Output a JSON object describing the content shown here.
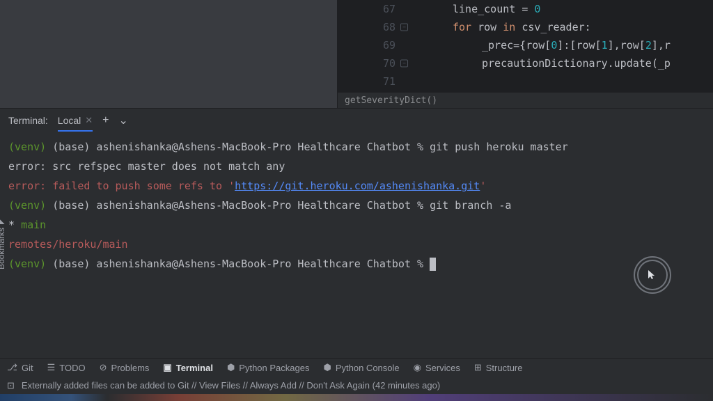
{
  "editor": {
    "lines": [
      {
        "num": "67",
        "fold": false,
        "code_html": "line_count = <span class='num'>0</span>",
        "indent": 560
      },
      {
        "num": "68",
        "fold": true,
        "code_html": "<span class='kw'>for</span> row <span class='kw'>in</span> csv_reader:",
        "indent": 560
      },
      {
        "num": "69",
        "fold": false,
        "code_html": "_prec={row[<span class='num'>0</span>]:[row[<span class='num'>1</span>],row[<span class='num'>2</span>],r",
        "indent": 602
      },
      {
        "num": "70",
        "fold": true,
        "code_html": "precautionDictionary.update(_p",
        "indent": 602
      },
      {
        "num": "71",
        "fold": false,
        "code_html": "",
        "indent": 560
      }
    ],
    "breadcrumb": "getSeverityDict()"
  },
  "terminal": {
    "title": "Terminal:",
    "tab": "Local",
    "lines": [
      {
        "segments": [
          {
            "cls": "t-green",
            "text": "(venv) "
          },
          {
            "cls": "",
            "text": "(base) ashenishanka@Ashens-MacBook-Pro Healthcare Chatbot % git push heroku master"
          }
        ]
      },
      {
        "segments": [
          {
            "cls": "",
            "text": "error: src refspec master does not match any"
          }
        ]
      },
      {
        "segments": [
          {
            "cls": "t-red",
            "text": "error: failed to push some refs to '"
          },
          {
            "cls": "t-url",
            "text": "https://git.heroku.com/ashenishanka.git"
          },
          {
            "cls": "t-red",
            "text": "'"
          }
        ]
      },
      {
        "segments": [
          {
            "cls": "t-green",
            "text": "(venv) "
          },
          {
            "cls": "",
            "text": "(base) ashenishanka@Ashens-MacBook-Pro Healthcare Chatbot % git branch -a"
          }
        ]
      },
      {
        "segments": [
          {
            "cls": "",
            "text": "* "
          },
          {
            "cls": "t-green",
            "text": "main"
          }
        ]
      },
      {
        "segments": [
          {
            "cls": "t-red",
            "text": "  remotes/heroku/main"
          }
        ]
      },
      {
        "segments": [
          {
            "cls": "t-green",
            "text": "(venv) "
          },
          {
            "cls": "",
            "text": "(base) ashenishanka@Ashens-MacBook-Pro Healthcare Chatbot % "
          }
        ],
        "cursor": true
      }
    ]
  },
  "bottom_tabs": [
    {
      "icon": "⎇",
      "label": "Git"
    },
    {
      "icon": "☰",
      "label": "TODO"
    },
    {
      "icon": "⊘",
      "label": "Problems"
    },
    {
      "icon": "▣",
      "label": "Terminal",
      "active": true
    },
    {
      "icon": "⬢",
      "label": "Python Packages"
    },
    {
      "icon": "⬢",
      "label": "Python Console"
    },
    {
      "icon": "◉",
      "label": "Services"
    },
    {
      "icon": "⊞",
      "label": "Structure"
    }
  ],
  "status": {
    "icon": "⊡",
    "message": "Externally added files can be added to Git // View Files // Always Add // Don't Ask Again (42 minutes ago)"
  },
  "side": {
    "icon": "◣",
    "label": "Bookmarks"
  }
}
